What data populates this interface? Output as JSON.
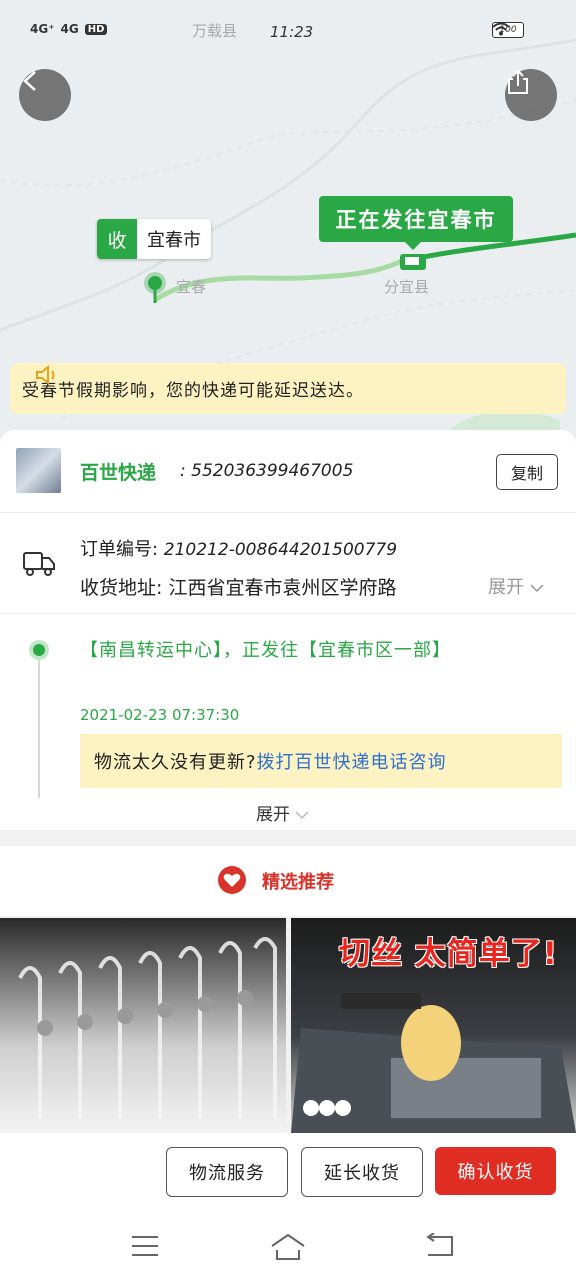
{
  "status_bar": {
    "signal1": "4G⁺",
    "signal2": "4G",
    "hd": "HD",
    "time": "11:23",
    "battery": "100"
  },
  "map": {
    "label_top": "万载县",
    "label_city": "宜春",
    "label_fenyi": "分宜县",
    "destination_key": "收",
    "destination_value": "宜春市",
    "route_bubble": "正在发往宜春市",
    "colors": {
      "route_active": "#2aa845",
      "route_done": "#a8dba3"
    }
  },
  "notice": {
    "text": "受春节假期影响，您的快递可能延迟送达。"
  },
  "shipment": {
    "carrier_name": "百世快递",
    "tracking_prefix": ": ",
    "tracking_number": "552036399467005",
    "copy_label": "复制",
    "order_label": "订单编号: ",
    "order_number": "210212-008644201500779",
    "address_label": "收货地址: ",
    "address": "江西省宜春市袁州区学府路",
    "address_expand": "展开"
  },
  "tracking": {
    "latest_text": "【南昌转运中心】，正发往【宜春市区一部】",
    "latest_time": "2021-02-23  07:37:30",
    "hint_prefix": "物流太久没有更新?",
    "hint_link": "拨打百世快递电话咨询",
    "expand_label": "展开"
  },
  "recommend": {
    "title": "精选推荐",
    "product_right_caption": "切丝 太简单了!"
  },
  "actions": {
    "logistics_service": "物流服务",
    "extend_receipt": "延长收货",
    "confirm_receipt": "确认收货",
    "confirm_color": "#e02d24"
  }
}
